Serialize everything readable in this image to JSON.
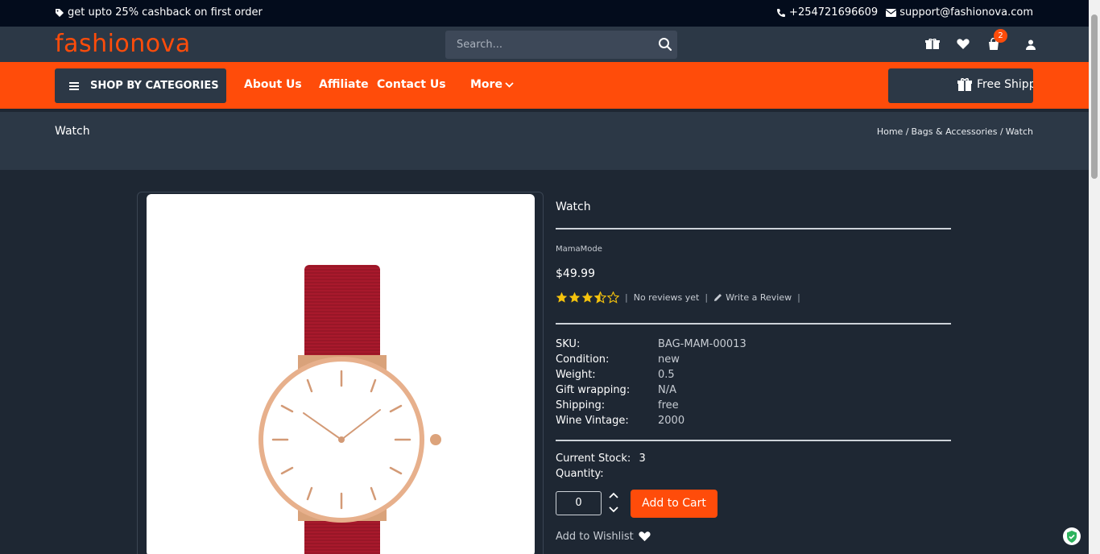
{
  "topbar": {
    "promo": "get upto 25% cashback on first order",
    "phone": "+254721696609",
    "email": "support@fashionova.com"
  },
  "header": {
    "logo": "fashionova",
    "search_placeholder": "Search...",
    "cart_count": "2"
  },
  "nav": {
    "shop_by": "SHOP BY CATEGORIES",
    "links": [
      "About Us",
      "Affiliate",
      "Contact Us",
      "More"
    ],
    "promo": "Free Shipping"
  },
  "breadcrumb": {
    "title": "Watch",
    "items": [
      "Home /",
      "Bags & Accessories /",
      "Watch"
    ]
  },
  "product": {
    "name": "Watch",
    "brand": "MamaMode",
    "price": "$49.99",
    "rating": 3.5,
    "reviews_text": "No reviews yet",
    "write_review": "Write a Review",
    "specs": [
      {
        "k": "SKU:",
        "v": "BAG-MAM-00013"
      },
      {
        "k": "Condition:",
        "v": "new"
      },
      {
        "k": "Weight:",
        "v": "0.5"
      },
      {
        "k": "Gift wrapping:",
        "v": "N/A"
      },
      {
        "k": "Shipping:",
        "v": "free"
      },
      {
        "k": "Wine Vintage:",
        "v": "2000"
      }
    ],
    "stock_label": "Current Stock:",
    "stock_value": "3",
    "quantity_label": "Quantity:",
    "quantity": "0",
    "add_to_cart": "Add to Cart",
    "wishlist": "Add to Wishlist"
  },
  "colors": {
    "accent": "#ff4c0a",
    "panel": "#2c3846",
    "background": "#1e2733"
  }
}
